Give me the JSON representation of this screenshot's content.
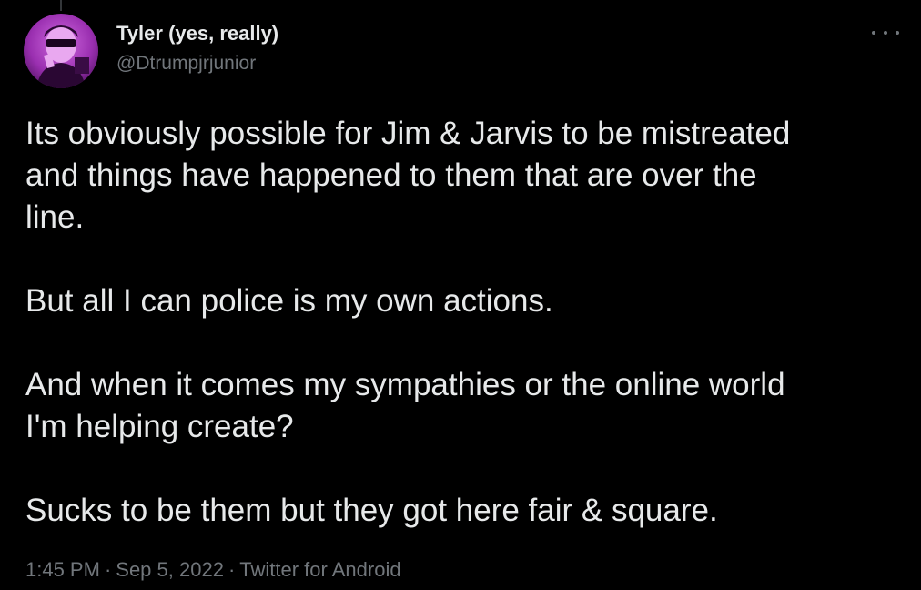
{
  "author": {
    "display_name": "Tyler (yes, really)",
    "handle": "@Dtrumpjrjunior"
  },
  "menu": {
    "more_icon": "more-horizontal-icon"
  },
  "tweet": {
    "paragraphs": [
      "Its obviously possible for Jim & Jarvis to be mistreated\nand things have happened to them that are over the\nline.",
      "But all I can police is my own actions.",
      "And when it comes my sympathies or the online world\nI'm helping create?",
      "Sucks to be them but they got here fair & square."
    ]
  },
  "meta": {
    "time": "1:45 PM",
    "separator": "·",
    "date": "Sep 5, 2022",
    "source": "Twitter for Android"
  },
  "colors": {
    "background": "#000000",
    "text": "#e7e9ea",
    "secondary": "#71767b",
    "avatar_tint": "#b43cc8"
  }
}
